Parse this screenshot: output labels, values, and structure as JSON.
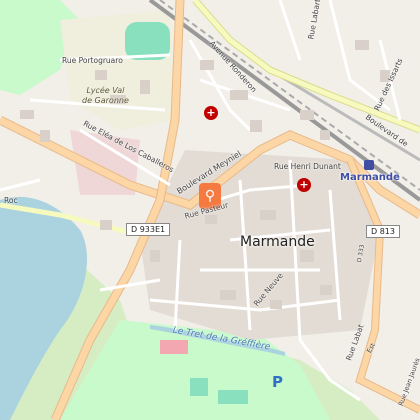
{
  "map": {
    "place_label": "Marmande",
    "station_label": "Marmande",
    "lycee_label_line1": "Lycée Val",
    "lycee_label_line2": "de Garonne",
    "river_label": "Le Tret de la Gréffière",
    "route_shield_1": "D 933E1",
    "route_shield_2": "D 813",
    "route_shield_3": "D 333",
    "streets": {
      "portogruaro": "Rue Portogruaro",
      "labarthe": "Rue Labarthe",
      "ronderon": "Avenue Ronderon",
      "issards": "Rue des Issarts",
      "boulevard_gare": "Boulevard de",
      "eleja": "Rue Eléa de Los Caballeros",
      "meyniel": "Boulevard Meyniel",
      "pasteur": "Rue Pasteur",
      "henri_dunant": "Rue Henri Dunant",
      "roc": "Roc",
      "neuve": "Rue Neuve",
      "labat": "Rue Labat",
      "jean_jaures": "Rue Jean Jaurès",
      "est": "Est"
    },
    "parking_label": "P",
    "colors": {
      "land": "#f2efe9",
      "water": "#aad3df",
      "park": "#c8facc",
      "pitch": "#88e0be",
      "major_road": "#fcd6a4",
      "secondary_road": "#f7fabf",
      "building": "#d9d0c9",
      "rail": "#888888",
      "marker": "#f47a42",
      "hospital": "#c00000"
    }
  }
}
